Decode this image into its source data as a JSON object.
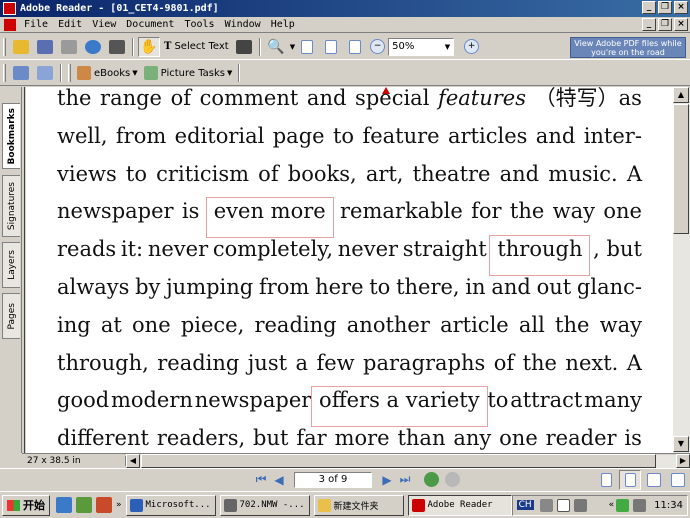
{
  "window": {
    "title": "Adobe Reader - [01_CET4-9801.pdf]"
  },
  "menu": [
    "File",
    "Edit",
    "View",
    "Document",
    "Tools",
    "Window",
    "Help"
  ],
  "toolbar": {
    "select_text_label": "Select Text",
    "zoom_value": "50%",
    "promo_label": "View Adobe PDF files while you're on the road",
    "ebooks_label": "eBooks",
    "picture_tasks_label": "Picture Tasks"
  },
  "side_tabs": [
    "Bookmarks",
    "Signatures",
    "Layers",
    "Pages"
  ],
  "document": {
    "lines": [
      [
        {
          "t": "the"
        },
        {
          "t": "range"
        },
        {
          "t": "of"
        },
        {
          "t": "comment"
        },
        {
          "t": "and"
        },
        {
          "t": "special"
        },
        {
          "t": "features",
          "it": true
        },
        {
          "t": "（特写）as"
        }
      ],
      [
        {
          "t": "well,"
        },
        {
          "t": "from"
        },
        {
          "t": "editorial"
        },
        {
          "t": "page"
        },
        {
          "t": "to"
        },
        {
          "t": "feature"
        },
        {
          "t": "articles"
        },
        {
          "t": "and"
        },
        {
          "t": "inter-"
        }
      ],
      [
        {
          "t": "views"
        },
        {
          "t": "to"
        },
        {
          "t": "criticism"
        },
        {
          "t": "of"
        },
        {
          "t": "books,"
        },
        {
          "t": "art,"
        },
        {
          "t": "theatre"
        },
        {
          "t": "and"
        },
        {
          "t": "music."
        },
        {
          "t": "A"
        }
      ],
      [
        {
          "t": "newspaper"
        },
        {
          "t": "is"
        },
        {
          "t": "even more",
          "hl": true
        },
        {
          "t": "remarkable"
        },
        {
          "t": "for"
        },
        {
          "t": "the"
        },
        {
          "t": "way"
        },
        {
          "t": "one"
        }
      ],
      [
        {
          "t": "reads"
        },
        {
          "t": "it:"
        },
        {
          "t": "never"
        },
        {
          "t": "completely,"
        },
        {
          "t": "never"
        },
        {
          "t": "straight"
        },
        {
          "t": "through",
          "hl": true
        },
        {
          "t": ", but"
        }
      ],
      [
        {
          "t": "always"
        },
        {
          "t": "by"
        },
        {
          "t": "jumping"
        },
        {
          "t": "from"
        },
        {
          "t": "here"
        },
        {
          "t": "to"
        },
        {
          "t": "there,"
        },
        {
          "t": "in"
        },
        {
          "t": "and"
        },
        {
          "t": "out"
        },
        {
          "t": "glanc-"
        }
      ],
      [
        {
          "t": "ing"
        },
        {
          "t": "at"
        },
        {
          "t": "one"
        },
        {
          "t": "piece,"
        },
        {
          "t": "reading"
        },
        {
          "t": "another"
        },
        {
          "t": "article"
        },
        {
          "t": "all"
        },
        {
          "t": "the"
        },
        {
          "t": "way"
        }
      ],
      [
        {
          "t": "through,"
        },
        {
          "t": "reading"
        },
        {
          "t": "just"
        },
        {
          "t": "a"
        },
        {
          "t": "few"
        },
        {
          "t": "paragraphs"
        },
        {
          "t": "of"
        },
        {
          "t": "the"
        },
        {
          "t": "next."
        },
        {
          "t": "A"
        }
      ],
      [
        {
          "t": "good"
        },
        {
          "t": "modern"
        },
        {
          "t": "newspaper"
        },
        {
          "t": "offers a variety",
          "hl": true
        },
        {
          "t": "to"
        },
        {
          "t": "attract"
        },
        {
          "t": "many"
        }
      ],
      [
        {
          "t": "different"
        },
        {
          "t": "readers,"
        },
        {
          "t": "but"
        },
        {
          "t": "far"
        },
        {
          "t": "more"
        },
        {
          "t": "than"
        },
        {
          "t": "any"
        },
        {
          "t": "one"
        },
        {
          "t": "reader"
        },
        {
          "t": "is"
        }
      ]
    ]
  },
  "status": {
    "page_size": "27 x 38.5 in",
    "page_indicator": "3 of 9"
  },
  "taskbar": {
    "start_label": "开始",
    "tasks": [
      {
        "label": "Microsoft...",
        "icon": "word-icon",
        "color": "#2b5fb8"
      },
      {
        "label": "702.NMW -...",
        "icon": "editor-icon",
        "color": "#666"
      },
      {
        "label": "新建文件夹",
        "icon": "folder-icon",
        "color": "#e8c04a"
      },
      {
        "label": "Adobe Reader",
        "icon": "adobe-reader-icon",
        "color": "#c00",
        "active": true
      }
    ],
    "tray_label": "CH",
    "clock": "11:34"
  }
}
